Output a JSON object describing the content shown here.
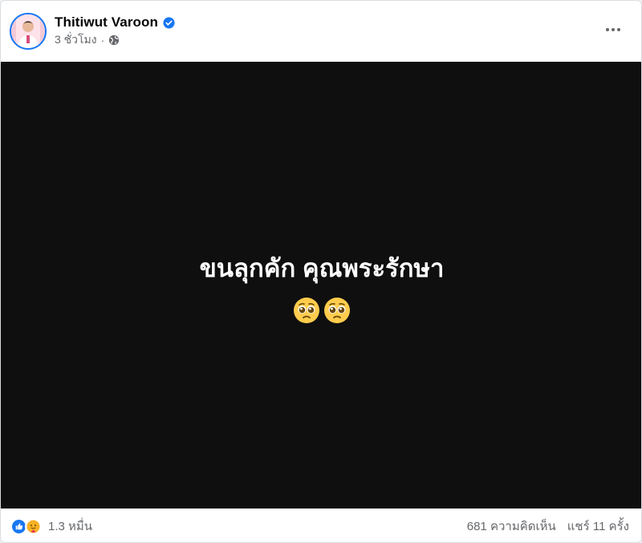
{
  "post": {
    "author_name": "Thitiwut Varoon",
    "time": "3 ชั่วโมง",
    "separator": "·",
    "privacy_icon": "globe-icon",
    "verified_icon": "verified-badge-icon",
    "more_icon": "more-options-icon",
    "text_line": "ขนลุกคัก คุณพระรักษา",
    "emojis": [
      "pleading-face-emoji",
      "pleading-face-emoji"
    ]
  },
  "footer": {
    "reaction_icons": [
      "like-icon",
      "care-icon"
    ],
    "reaction_count": "1.3 หมื่น",
    "comments": "681 ความคิดเห็น",
    "shares": "แชร์ 11 ครั้ง"
  },
  "colors": {
    "brand": "#1877f2",
    "media_bg": "#0f0f0f",
    "secondary_text": "#65676b"
  }
}
